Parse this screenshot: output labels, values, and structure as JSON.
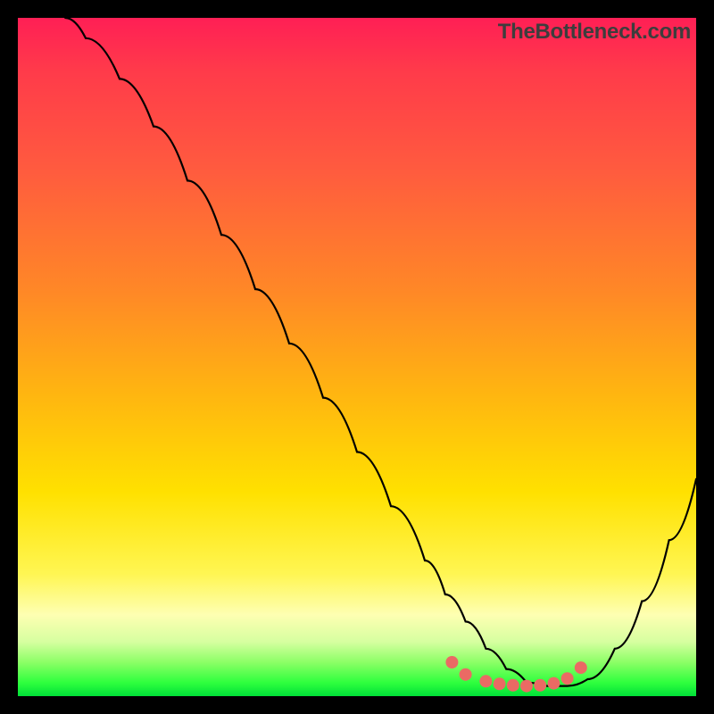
{
  "watermark": "TheBottleneck.com",
  "chart_data": {
    "type": "line",
    "title": "",
    "xlabel": "",
    "ylabel": "",
    "xlim": [
      0,
      100
    ],
    "ylim": [
      0,
      100
    ],
    "grid": false,
    "legend": false,
    "series": [
      {
        "name": "curve",
        "color": "#000000",
        "x": [
          7,
          10,
          15,
          20,
          25,
          30,
          35,
          40,
          45,
          50,
          55,
          60,
          63,
          66,
          69,
          72,
          75,
          78,
          81,
          84,
          88,
          92,
          96,
          100
        ],
        "y": [
          100,
          97,
          91,
          84,
          76,
          68,
          60,
          52,
          44,
          36,
          28,
          20,
          15,
          11,
          7,
          4,
          2,
          1.5,
          1.5,
          2.5,
          7,
          14,
          23,
          32
        ]
      }
    ],
    "markers": {
      "name": "dots",
      "color": "#ea6a64",
      "radius": 7,
      "x": [
        64,
        66,
        69,
        71,
        73,
        75,
        77,
        79,
        81,
        83
      ],
      "y": [
        5,
        3.2,
        2.2,
        1.8,
        1.6,
        1.5,
        1.6,
        1.9,
        2.6,
        4.2
      ]
    },
    "gradient_stops": [
      {
        "pos": 0,
        "color": "#ff1f55"
      },
      {
        "pos": 8,
        "color": "#ff3b4a"
      },
      {
        "pos": 22,
        "color": "#ff5a3f"
      },
      {
        "pos": 40,
        "color": "#ff8727"
      },
      {
        "pos": 55,
        "color": "#ffb411"
      },
      {
        "pos": 70,
        "color": "#ffe100"
      },
      {
        "pos": 82,
        "color": "#fff653"
      },
      {
        "pos": 88,
        "color": "#feffb2"
      },
      {
        "pos": 92,
        "color": "#d6ffa0"
      },
      {
        "pos": 95,
        "color": "#8cff66"
      },
      {
        "pos": 98,
        "color": "#2fff3e"
      },
      {
        "pos": 100,
        "color": "#00e038"
      }
    ]
  }
}
